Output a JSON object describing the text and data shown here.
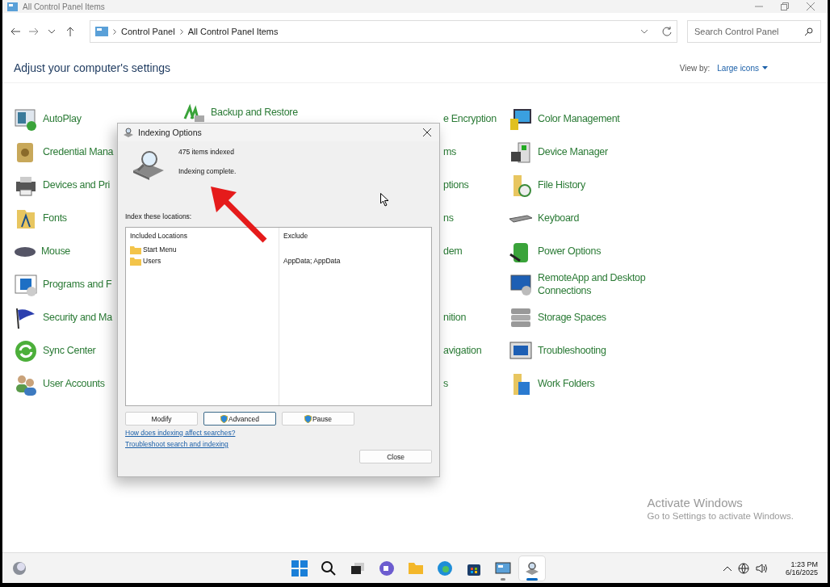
{
  "window": {
    "title": "All Control Panel Items"
  },
  "address_bar": {
    "breadcrumbs": [
      "Control Panel",
      "All Control Panel Items"
    ]
  },
  "search": {
    "placeholder": "Search Control Panel"
  },
  "heading": "Adjust your computer's settings",
  "view_by": {
    "label": "View by:",
    "value": "Large icons"
  },
  "columns": [
    [
      {
        "kind": "full",
        "label": "AutoPlay"
      },
      {
        "kind": "full",
        "label": "Credential Mana"
      },
      {
        "kind": "full",
        "label": "Devices and Pri"
      },
      {
        "kind": "full",
        "label": "Fonts"
      },
      {
        "kind": "full",
        "label": "Mouse"
      },
      {
        "kind": "full",
        "label": "Programs and F"
      },
      {
        "kind": "full",
        "label": "Security and Ma"
      },
      {
        "kind": "full",
        "label": "Sync Center"
      },
      {
        "kind": "full",
        "label": "User Accounts"
      }
    ],
    [
      {
        "kind": "full",
        "label": "Backup and Restore"
      }
    ],
    [
      {
        "kind": "partial",
        "label": "e Encryption"
      },
      {
        "kind": "partial",
        "label": "ms"
      },
      {
        "kind": "partial",
        "label": "ptions"
      },
      {
        "kind": "partial",
        "label": "ns"
      },
      {
        "kind": "partial",
        "label": "dem"
      },
      {
        "kind": "gap"
      },
      {
        "kind": "partial",
        "label": "nition"
      },
      {
        "kind": "partial",
        "label": "avigation"
      },
      {
        "kind": "partial",
        "label": "s"
      }
    ],
    [
      {
        "kind": "full",
        "label": "Color Management"
      },
      {
        "kind": "full",
        "label": "Device Manager"
      },
      {
        "kind": "full",
        "label": "File History"
      },
      {
        "kind": "full",
        "label": "Keyboard"
      },
      {
        "kind": "full",
        "label": "Power Options"
      },
      {
        "kind": "full",
        "label": "RemoteApp and Desktop Connections"
      },
      {
        "kind": "full",
        "label": "Storage Spaces"
      },
      {
        "kind": "full",
        "label": "Troubleshooting"
      },
      {
        "kind": "full",
        "label": "Work Folders"
      }
    ]
  ],
  "dialog": {
    "title": "Indexing Options",
    "status_count": "475 items indexed",
    "status": "Indexing complete.",
    "locations_label": "Index these locations:",
    "list": {
      "columns": [
        "Included Locations",
        "Exclude"
      ],
      "rows": [
        {
          "location": "Start Menu"
        },
        {
          "location": "Users",
          "exclude": "AppData; AppData"
        }
      ]
    },
    "buttons": [
      {
        "label": "Modify",
        "shield": false,
        "focused": false
      },
      {
        "label": "Advanced",
        "shield": true,
        "focused": true
      },
      {
        "label": "Pause",
        "shield": true,
        "focused": false
      }
    ],
    "links": [
      "How does indexing affect searches?",
      "Troubleshoot search and indexing"
    ],
    "close_button": "Close"
  },
  "activation": {
    "title": "Activate Windows",
    "text": "Go to Settings to activate Windows."
  },
  "taskbar": {
    "apps": [
      {
        "running": false,
        "selected": false
      },
      {
        "running": false,
        "selected": false
      },
      {
        "running": false,
        "selected": false
      },
      {
        "running": false,
        "selected": false
      },
      {
        "running": false,
        "selected": false
      },
      {
        "running": false,
        "selected": false
      },
      {
        "running": false,
        "selected": false
      },
      {
        "running": true,
        "selected": false
      },
      {
        "running": true,
        "selected": true
      }
    ],
    "time": "1:23 PM",
    "date": "6/16/2025"
  }
}
